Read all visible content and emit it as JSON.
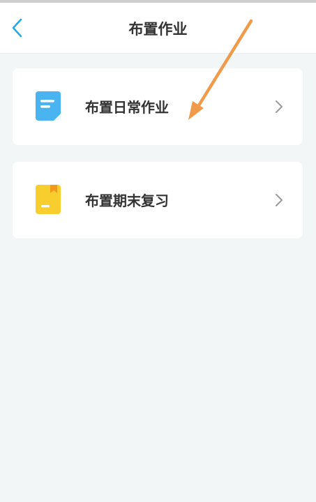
{
  "header": {
    "title": "布置作业",
    "back_icon": "chevron-left-icon"
  },
  "menu": {
    "items": [
      {
        "label": "布置日常作业",
        "icon": "document-icon",
        "icon_color": "#4ab4f0"
      },
      {
        "label": "布置期末复习",
        "icon": "book-icon",
        "icon_color": "#f8cd2e"
      }
    ]
  },
  "colors": {
    "accent": "#27a9e1",
    "annotation_arrow": "#f09a4a",
    "background": "#f3f6f7"
  }
}
